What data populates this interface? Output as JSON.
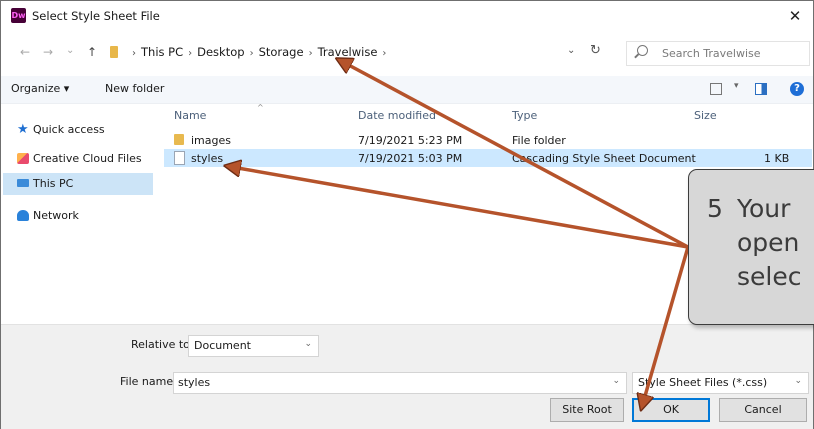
{
  "window": {
    "title": "Select Style Sheet File",
    "app_icon_text": "Dw",
    "close_glyph": "✕"
  },
  "nav": {
    "back": "←",
    "forward": "→",
    "recent": "⌄",
    "up": "↑"
  },
  "breadcrumb": {
    "items": [
      "This PC",
      "Desktop",
      "Storage",
      "Travelwise"
    ],
    "separator": "›"
  },
  "address": {
    "dropdown": "⌄",
    "refresh": "↻"
  },
  "search": {
    "placeholder": "Search Travelwise"
  },
  "toolbar": {
    "organize": "Organize ▾",
    "new_folder": "New folder",
    "view_dropdown": "▾",
    "help": "?"
  },
  "sidebar": {
    "items": [
      {
        "label": "Quick access",
        "icon": "star-icon"
      },
      {
        "label": "Creative Cloud Files",
        "icon": "creative-cloud-icon"
      },
      {
        "label": "This PC",
        "icon": "computer-icon",
        "selected": true
      },
      {
        "label": "Network",
        "icon": "network-icon"
      }
    ]
  },
  "file_list": {
    "columns": [
      "Name",
      "Date modified",
      "Type",
      "Size"
    ],
    "sort_glyph": "^",
    "rows": [
      {
        "name": "images",
        "date": "7/19/2021 5:23 PM",
        "type": "File folder",
        "size": "",
        "icon": "folder-icon"
      },
      {
        "name": "styles",
        "date": "7/19/2021 5:03 PM",
        "type": "Cascading Style Sheet Document",
        "size": "1 KB",
        "icon": "css-file-icon",
        "selected": true
      }
    ]
  },
  "bottom": {
    "relative_label": "Relative to:",
    "relative_value": "Document",
    "filename_label": "File name:",
    "filename_value": "styles",
    "filetype_value": "Style Sheet Files (*.css)",
    "dropdown_glyph": "⌄",
    "site_root": "Site Root",
    "ok": "OK",
    "cancel": "Cancel"
  },
  "callout": {
    "number": "5",
    "lines": [
      "Your",
      "open",
      "selec"
    ]
  },
  "colors": {
    "arrow": "#b5532b",
    "selection": "#cce8ff",
    "accent": "#0078d7"
  }
}
